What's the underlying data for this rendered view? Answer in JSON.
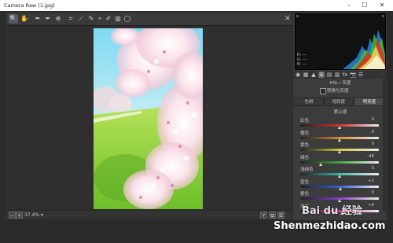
{
  "window": {
    "title": "Camera Raw (1.jpg)",
    "minimize": "–",
    "maximize": "☐",
    "close": "✕"
  },
  "toolbar": {
    "tools": [
      {
        "name": "zoom-tool",
        "glyph": "🔍"
      },
      {
        "name": "hand-tool",
        "glyph": "✋"
      },
      {
        "name": "white-balance-tool",
        "glyph": "✒"
      },
      {
        "name": "color-sampler-tool",
        "glyph": "✒"
      },
      {
        "name": "targeted-adjustment-tool",
        "glyph": "⊕"
      },
      {
        "name": "crop-tool",
        "glyph": "⌗"
      },
      {
        "name": "straighten-tool",
        "glyph": "⟋"
      },
      {
        "name": "spot-removal-tool",
        "glyph": "✎"
      },
      {
        "name": "red-eye-tool",
        "glyph": "⚬"
      },
      {
        "name": "adjustment-brush-tool",
        "glyph": "✐"
      },
      {
        "name": "graduated-filter-tool",
        "glyph": "▥"
      },
      {
        "name": "radial-filter-tool",
        "glyph": "◯"
      }
    ],
    "export_glyph": "⇲"
  },
  "status": {
    "zoom": "37.4%",
    "zoom_arrow": "▾",
    "zoom_out": "−",
    "zoom_in": "+",
    "right_buttons": [
      "Y",
      "⧉",
      "☰"
    ]
  },
  "histogram": {
    "rgb_labels": [
      "R:  ---",
      "G:  ---",
      "B:  ---"
    ]
  },
  "panel": {
    "icons": [
      "◉",
      "▦",
      "▲",
      "≣",
      "▤",
      "▥",
      "fx",
      "📷",
      "☰"
    ],
    "selected_icon": 3,
    "section_title": "HSL / 灰度",
    "convert_label": "转换为灰度",
    "tabs": [
      "色相",
      "饱和度",
      "明亮度"
    ],
    "active_tab": 2,
    "subhead": "默认值",
    "sliders": [
      {
        "label": "红色",
        "value": "0",
        "pos": 0.5,
        "gradient": "#cc3333"
      },
      {
        "label": "橙色",
        "value": "0",
        "pos": 0.5,
        "gradient": "#d98a2b"
      },
      {
        "label": "黄色",
        "value": "0",
        "pos": 0.5,
        "gradient": "#d4c93a"
      },
      {
        "label": "绿色",
        "value": "-48",
        "pos": 0.26,
        "gradient": "#3fa53f"
      },
      {
        "label": "浅绿色",
        "value": "0",
        "pos": 0.5,
        "gradient": "#3ab7a8"
      },
      {
        "label": "蓝色",
        "value": "+2",
        "pos": 0.51,
        "gradient": "#3a5fd0"
      },
      {
        "label": "紫色",
        "value": "0",
        "pos": 0.5,
        "gradient": "#8a3ad0"
      },
      {
        "label": "洋红",
        "value": "+6",
        "pos": 0.53,
        "gradient": "#d03aa5"
      }
    ]
  },
  "watermark": {
    "logo": "Bai du 经验",
    "site": "Shenmezhidao.com"
  }
}
